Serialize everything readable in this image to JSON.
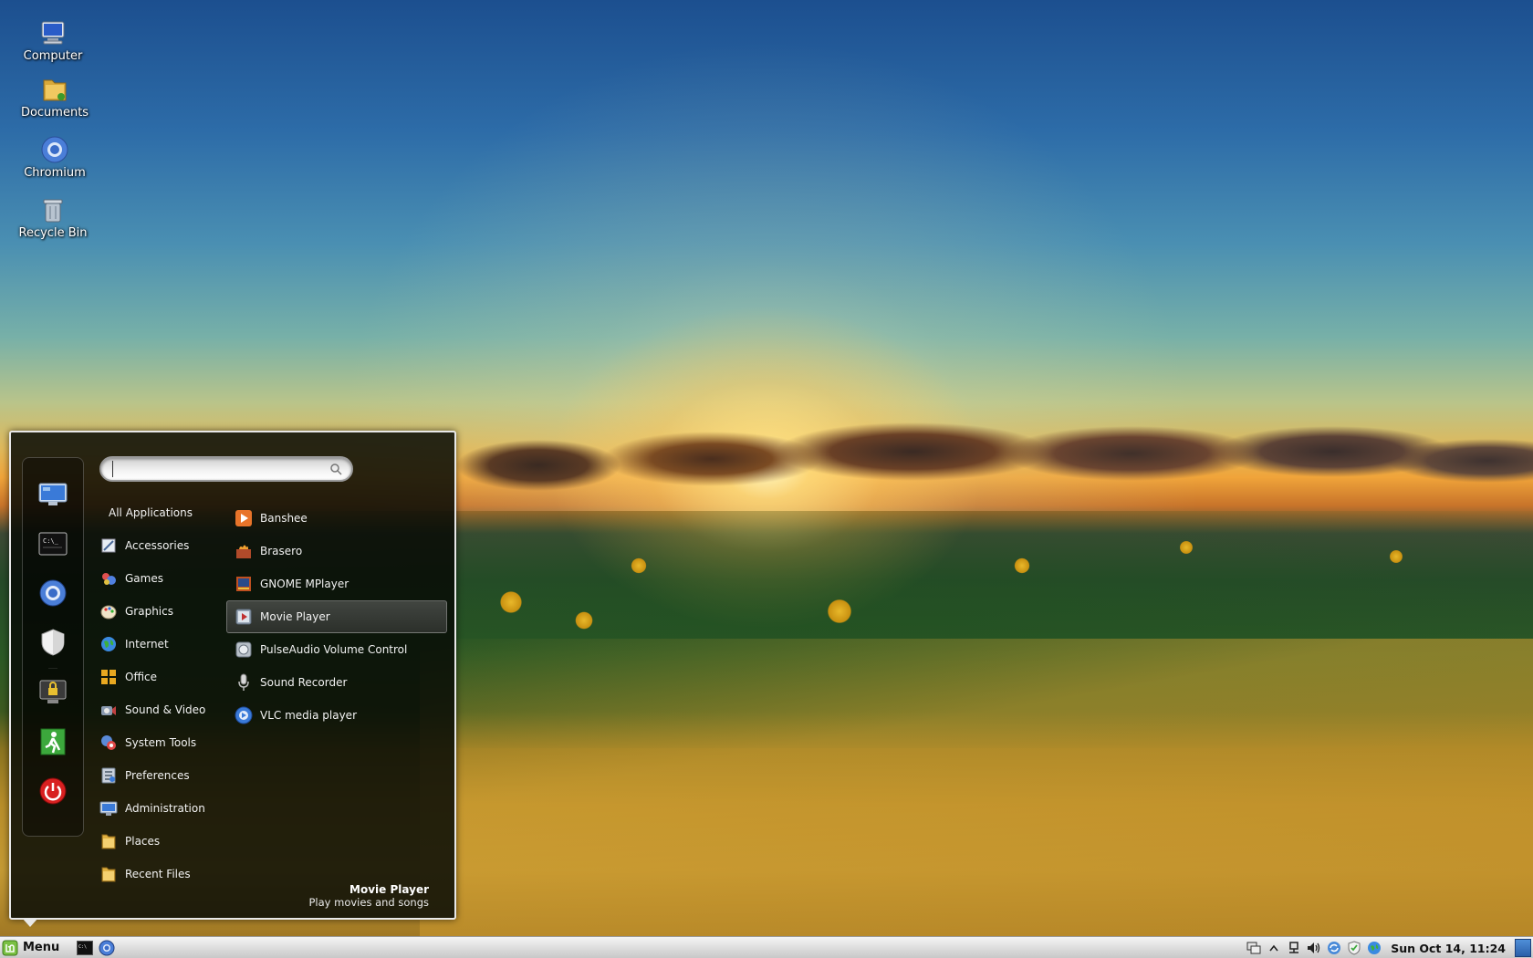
{
  "desktop": {
    "icons": [
      {
        "label": "Computer",
        "icon": "computer-icon"
      },
      {
        "label": "Documents",
        "icon": "folder-icon"
      },
      {
        "label": "Chromium",
        "icon": "chromium-icon"
      },
      {
        "label": "Recycle Bin",
        "icon": "trash-icon"
      }
    ]
  },
  "menu": {
    "search": {
      "value": "",
      "placeholder": ""
    },
    "favorites": [
      {
        "name": "computer-icon"
      },
      {
        "name": "terminal-icon"
      },
      {
        "name": "chromium-icon"
      },
      {
        "name": "shield-icon"
      },
      {
        "name": "lock-screen-icon"
      },
      {
        "name": "logout-icon"
      },
      {
        "name": "power-icon"
      }
    ],
    "categories": [
      {
        "label": "All Applications"
      },
      {
        "label": "Accessories"
      },
      {
        "label": "Games"
      },
      {
        "label": "Graphics"
      },
      {
        "label": "Internet"
      },
      {
        "label": "Office"
      },
      {
        "label": "Sound & Video"
      },
      {
        "label": "System Tools"
      },
      {
        "label": "Preferences"
      },
      {
        "label": "Administration"
      },
      {
        "label": "Places"
      },
      {
        "label": "Recent Files"
      }
    ],
    "apps": [
      {
        "label": "Banshee"
      },
      {
        "label": "Brasero"
      },
      {
        "label": "GNOME MPlayer"
      },
      {
        "label": "Movie Player",
        "selected": true
      },
      {
        "label": "PulseAudio Volume Control"
      },
      {
        "label": "Sound Recorder"
      },
      {
        "label": "VLC media player"
      }
    ],
    "info": {
      "title": "Movie Player",
      "description": "Play movies and songs"
    }
  },
  "taskbar": {
    "menu_label": "Menu",
    "clock": "Sun Oct 14, 11:24"
  },
  "colors": {
    "panel_bg": "#0a0e08",
    "panel_border": "#e8e8e8",
    "taskbar_bg": "#dcdcdc",
    "accent_green": "#3c9a2a"
  }
}
